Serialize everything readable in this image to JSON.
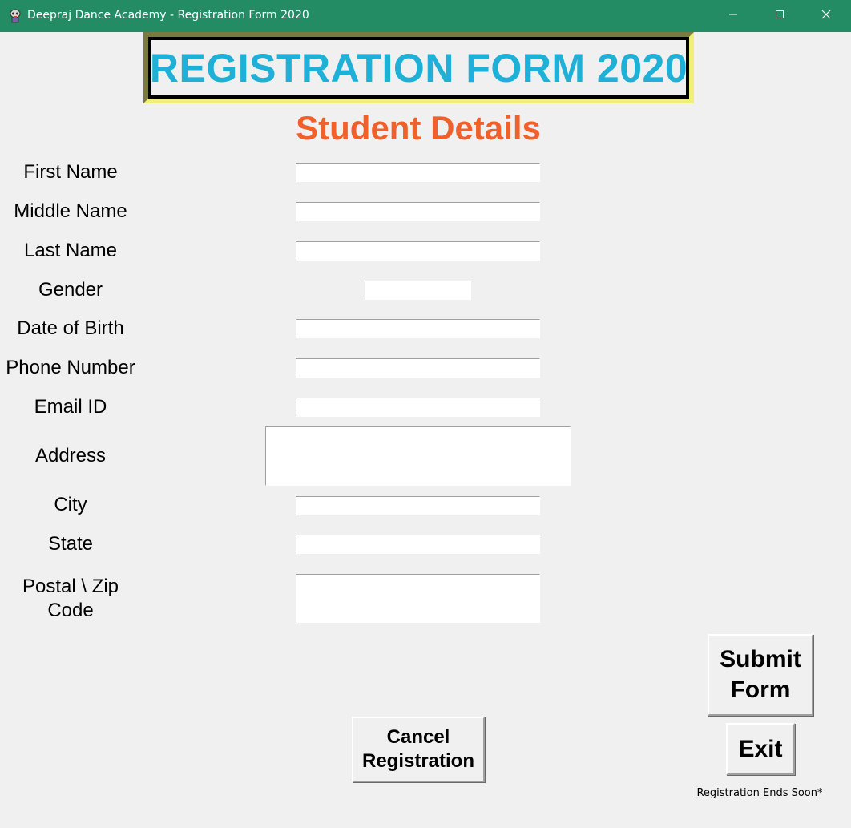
{
  "window": {
    "title": "Deepraj Dance Academy - Registration Form 2020",
    "icon": "app-mascot-icon",
    "controls": [
      "minimize-icon",
      "maximize-icon",
      "close-icon"
    ]
  },
  "banner": {
    "title": "REGISTRATION FORM 2020"
  },
  "section": {
    "title": "Student Details"
  },
  "form": {
    "first_name": {
      "label": "First Name",
      "value": ""
    },
    "middle_name": {
      "label": "Middle Name",
      "value": ""
    },
    "last_name": {
      "label": "Last Name",
      "value": ""
    },
    "gender": {
      "label": "Gender",
      "value": ""
    },
    "dob": {
      "label": "Date of Birth",
      "value": ""
    },
    "phone": {
      "label": "Phone Number",
      "value": ""
    },
    "email": {
      "label": "Email ID",
      "value": ""
    },
    "address": {
      "label": "Address",
      "value": ""
    },
    "city": {
      "label": "City",
      "value": ""
    },
    "state": {
      "label": "State",
      "value": ""
    },
    "postal": {
      "label": "Postal \\ Zip Code",
      "value": ""
    }
  },
  "buttons": {
    "submit": "Submit\nForm",
    "exit": "Exit",
    "cancel": "Cancel\nRegistration"
  },
  "footnote": "Registration Ends Soon*",
  "colors": {
    "titlebar": "#238c65",
    "banner_text": "#1fb0d8",
    "section_title": "#f0602a",
    "background": "#f0f0f0"
  }
}
